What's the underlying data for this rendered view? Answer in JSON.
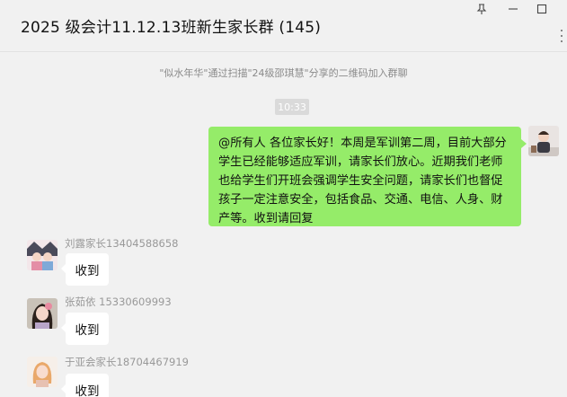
{
  "window": {
    "title": "2025 级会计11.12.13班新生家长群 (145)",
    "controls": {
      "pin": "📌",
      "minimize": "—",
      "maximize": "☐"
    }
  },
  "chat": {
    "system_notice": "\"似水年华\"通过扫描\"24级邵琪慧\"分享的二维码加入群聊",
    "timestamp": "10:33",
    "outgoing_message": "@所有人 各位家长好！本周是军训第二周，目前大部分学生已经能够适应军训，请家长们放心。近期我们老师也给学生们开班会强调学生安全问题，请家长们也督促孩子一定注意安全，包括食品、交通、电信、人身、财产等。收到请回复",
    "incoming": [
      {
        "sender": "刘露家长13404588658",
        "text": "收到"
      },
      {
        "sender": "张茹依    15330609993",
        "text": "收到"
      },
      {
        "sender": "于亚会家长18704467919",
        "text": "收到"
      }
    ]
  },
  "icons": {
    "pin": "pin-icon",
    "minimize": "minimize-icon",
    "maximize": "maximize-icon",
    "more": "more-icon"
  }
}
